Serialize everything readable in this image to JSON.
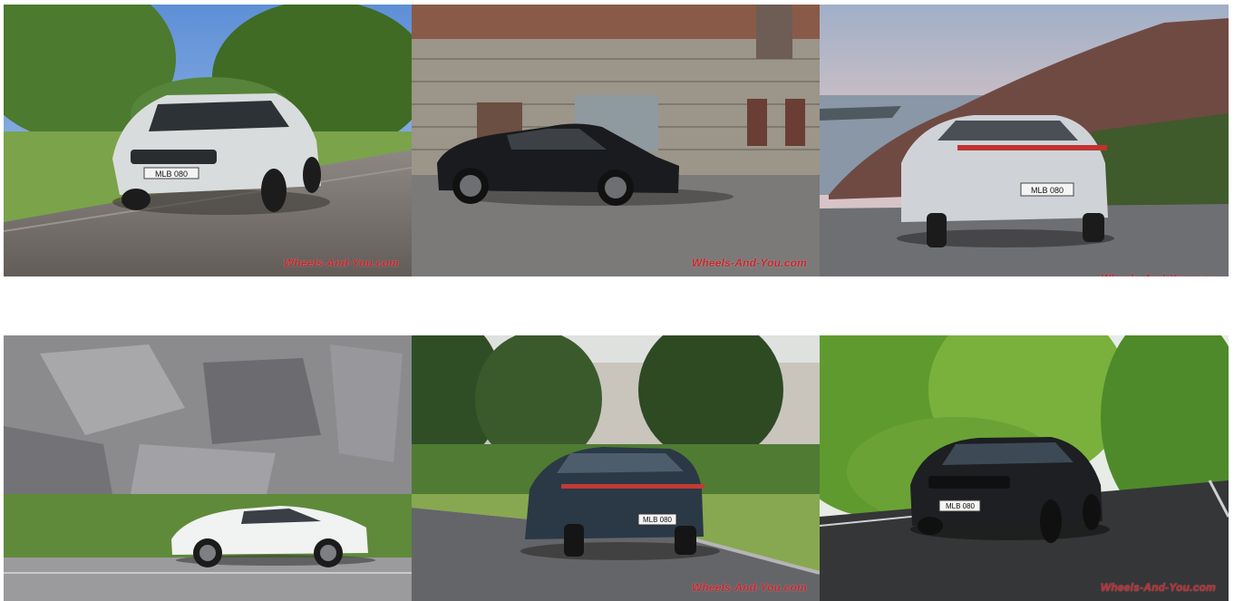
{
  "gallery": {
    "watermark_text": "Wheels-And-You.com",
    "photos": [
      {
        "subject": "silver sedan front three-quarter on rural road",
        "plate": "MLB 080"
      },
      {
        "subject": "black sedan side profile in front of old building",
        "plate": ""
      },
      {
        "subject": "silver sedan rear view on coastal road",
        "plate": "MLB 080"
      },
      {
        "subject": "white sedan side profile in motion by rock wall",
        "plate": ""
      },
      {
        "subject": "dark blue sedan rear three-quarter on curved road",
        "plate": "MLB 080"
      },
      {
        "subject": "black sedan front view on forest road",
        "plate": "MLB 080"
      }
    ]
  },
  "colors": {
    "watermark": "#c7242b",
    "background": "#ffffff"
  }
}
